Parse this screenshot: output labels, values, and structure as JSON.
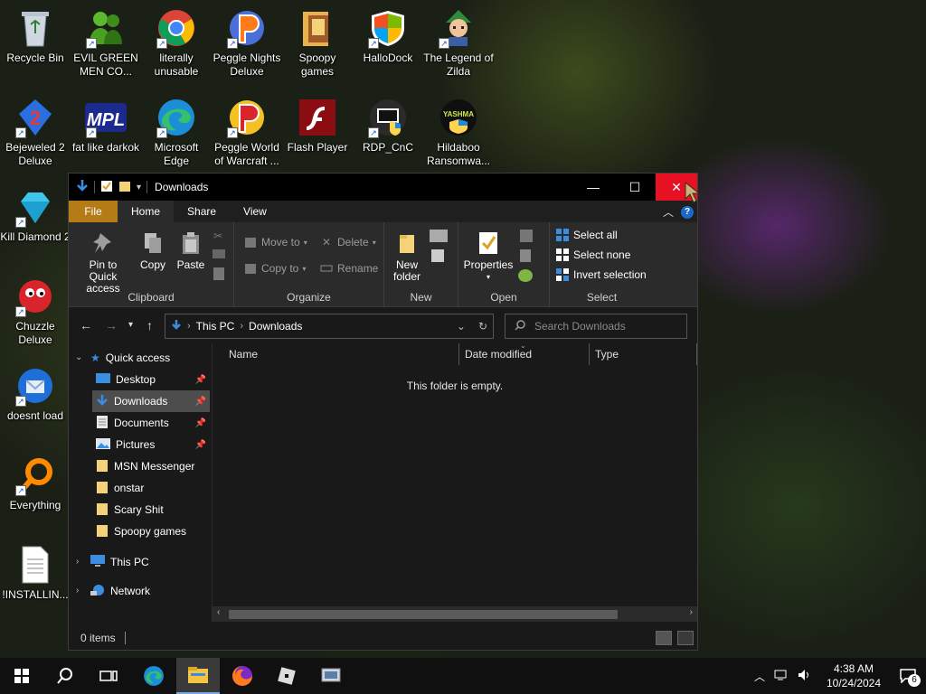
{
  "desktop": {
    "icons": [
      {
        "label": "Recycle Bin"
      },
      {
        "label": "EVIL GREEN MEN CO..."
      },
      {
        "label": "literally unusable"
      },
      {
        "label": "Peggle Nights Deluxe"
      },
      {
        "label": "Spoopy games"
      },
      {
        "label": "HalloDock"
      },
      {
        "label": "The Legend of Zilda"
      },
      {
        "label": "Bejeweled 2 Deluxe"
      },
      {
        "label": "fat like darkok"
      },
      {
        "label": "Microsoft Edge"
      },
      {
        "label": "Peggle World of Warcraft ..."
      },
      {
        "label": "Flash Player"
      },
      {
        "label": "RDP_CnC"
      },
      {
        "label": "Hildaboo Ransomwa..."
      },
      {
        "label": "Kill Diamond 2"
      },
      {
        "label": "Chuzzle Deluxe"
      },
      {
        "label": "doesnt load"
      },
      {
        "label": "Everything"
      },
      {
        "label": "!INSTALLIN..."
      }
    ],
    "icon_text": {
      "mpl": "MPL",
      "yashma": "YASHMA"
    }
  },
  "explorer": {
    "title": "Downloads",
    "window_controls": {
      "minimize": "—",
      "maximize": "☐",
      "close": "✕"
    },
    "help": "?",
    "tabs": {
      "file": "File",
      "home": "Home",
      "share": "Share",
      "view": "View"
    },
    "ribbon": {
      "clipboard": {
        "label": "Clipboard",
        "pin": "Pin to Quick access",
        "copy": "Copy",
        "paste": "Paste"
      },
      "organize": {
        "label": "Organize",
        "move_to": "Move to",
        "copy_to": "Copy to",
        "delete": "Delete",
        "rename": "Rename"
      },
      "new": {
        "label": "New",
        "new_folder": "New folder"
      },
      "open": {
        "label": "Open",
        "properties": "Properties"
      },
      "select": {
        "label": "Select",
        "select_all": "Select all",
        "select_none": "Select none",
        "invert": "Invert selection"
      }
    },
    "address": {
      "crumbs": [
        "This PC",
        "Downloads"
      ]
    },
    "search": {
      "placeholder": "Search Downloads"
    },
    "nav": {
      "quick_access": "Quick access",
      "items": [
        "Desktop",
        "Downloads",
        "Documents",
        "Pictures",
        "MSN Messenger",
        "onstar",
        "Scary Shit",
        "Spoopy games"
      ],
      "this_pc": "This PC",
      "network": "Network"
    },
    "columns": {
      "name": "Name",
      "date_modified": "Date modified",
      "type": "Type"
    },
    "empty_message": "This folder is empty.",
    "status": {
      "items": "0 items"
    }
  },
  "taskbar": {
    "time": "4:38 AM",
    "date": "10/24/2024",
    "notification_count": "6"
  },
  "colors": {
    "close_red": "#e81123",
    "file_tab": "#b57b16",
    "selection": "#4d4d4d"
  }
}
